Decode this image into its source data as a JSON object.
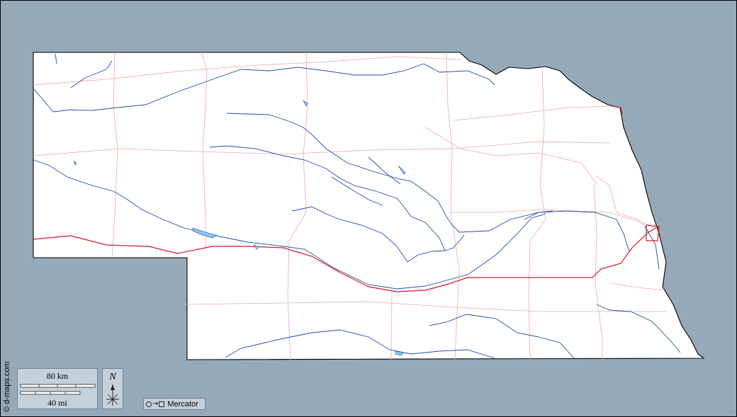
{
  "credit": "© d-maps.com",
  "scale": {
    "km_label": "80 km",
    "mi_label": "40 mi"
  },
  "north": {
    "label": "N"
  },
  "projection": {
    "label": "Mercator"
  },
  "colors": {
    "sea": "#95a9b8",
    "land": "#ffffff",
    "rivers": "#1e4fa8",
    "roads": "#f0a8a8",
    "highway": "#d8162a",
    "lakes": "#8cc4ec"
  }
}
